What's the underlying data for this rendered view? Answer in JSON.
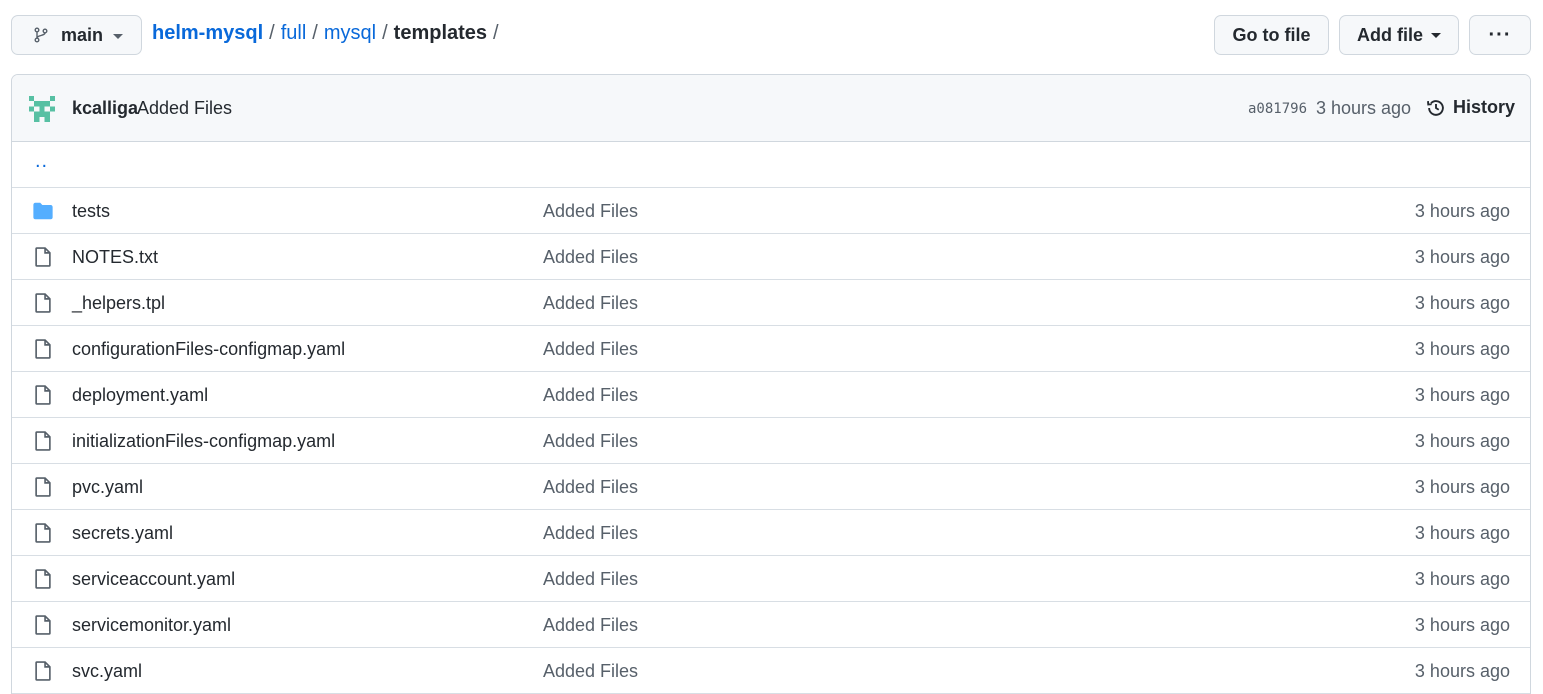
{
  "branch": {
    "name": "main",
    "icon": "git-branch-icon"
  },
  "breadcrumb": {
    "repo": "helm-mysql",
    "parts": [
      "full",
      "mysql"
    ],
    "current": "templates",
    "separator": "/"
  },
  "actions": {
    "go_to_file": "Go to file",
    "add_file": "Add file",
    "more": "···"
  },
  "commit": {
    "author": "kcalliga",
    "message": "Added Files",
    "sha": "a081796",
    "time": "3 hours ago",
    "history_label": "History"
  },
  "parent_link": "..",
  "files": [
    {
      "name": "tests",
      "type": "folder",
      "message": "Added Files",
      "time": "3 hours ago"
    },
    {
      "name": "NOTES.txt",
      "type": "file",
      "message": "Added Files",
      "time": "3 hours ago"
    },
    {
      "name": "_helpers.tpl",
      "type": "file",
      "message": "Added Files",
      "time": "3 hours ago"
    },
    {
      "name": "configurationFiles-configmap.yaml",
      "type": "file",
      "message": "Added Files",
      "time": "3 hours ago"
    },
    {
      "name": "deployment.yaml",
      "type": "file",
      "message": "Added Files",
      "time": "3 hours ago"
    },
    {
      "name": "initializationFiles-configmap.yaml",
      "type": "file",
      "message": "Added Files",
      "time": "3 hours ago"
    },
    {
      "name": "pvc.yaml",
      "type": "file",
      "message": "Added Files",
      "time": "3 hours ago"
    },
    {
      "name": "secrets.yaml",
      "type": "file",
      "message": "Added Files",
      "time": "3 hours ago"
    },
    {
      "name": "serviceaccount.yaml",
      "type": "file",
      "message": "Added Files",
      "time": "3 hours ago"
    },
    {
      "name": "servicemonitor.yaml",
      "type": "file",
      "message": "Added Files",
      "time": "3 hours ago"
    },
    {
      "name": "svc.yaml",
      "type": "file",
      "message": "Added Files",
      "time": "3 hours ago"
    }
  ],
  "colors": {
    "link": "#0969da",
    "folder": "#54aeff",
    "muted": "#57606a",
    "avatar": "#57c0a3"
  }
}
